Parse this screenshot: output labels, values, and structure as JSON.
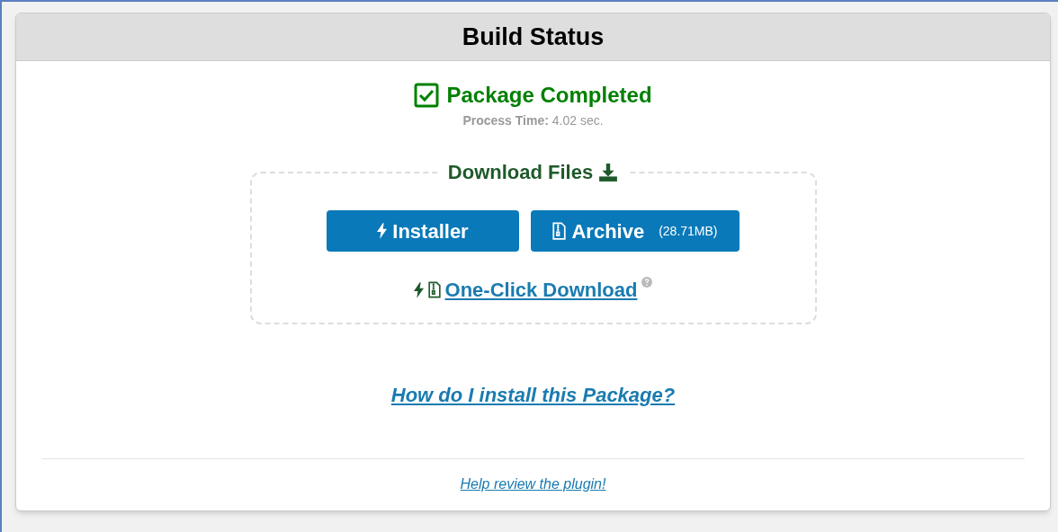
{
  "panel": {
    "title": "Build Status"
  },
  "status": {
    "kind": "success",
    "title": "Package Completed",
    "process_time": "**Process Time:** 4.02 sec."
  },
  "download": {
    "legend": "Download Files",
    "buttons": [
      {
        "kind": "installer",
        "label": "Installer"
      },
      {
        "kind": "archive",
        "label": "Archive",
        "size": "(28.71MB)"
      }
    ],
    "one_click": "One-Click Download"
  },
  "help_link": "How do I install this Package?",
  "footer_link": "Help review the plugin!"
}
